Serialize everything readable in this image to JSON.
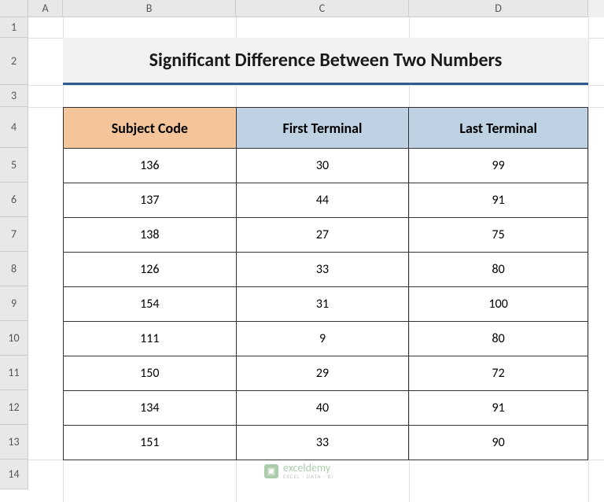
{
  "columns": [
    "A",
    "B",
    "C",
    "D"
  ],
  "rows": [
    "1",
    "2",
    "3",
    "4",
    "5",
    "6",
    "7",
    "8",
    "9",
    "10",
    "11",
    "12",
    "13",
    "14"
  ],
  "title": "Significant Difference Between Two Numbers",
  "headers": {
    "subject": "Subject Code",
    "first": "First Terminal",
    "last": "Last Terminal"
  },
  "chart_data": {
    "type": "table",
    "title": "Significant Difference Between Two Numbers",
    "columns": [
      "Subject Code",
      "First Terminal",
      "Last Terminal"
    ],
    "rows": [
      {
        "subject": "136",
        "first": "30",
        "last": "99"
      },
      {
        "subject": "137",
        "first": "44",
        "last": "91"
      },
      {
        "subject": "138",
        "first": "27",
        "last": "75"
      },
      {
        "subject": "126",
        "first": "33",
        "last": "80"
      },
      {
        "subject": "154",
        "first": "31",
        "last": "100"
      },
      {
        "subject": "111",
        "first": "9",
        "last": "80"
      },
      {
        "subject": "150",
        "first": "29",
        "last": "72"
      },
      {
        "subject": "134",
        "first": "40",
        "last": "91"
      },
      {
        "subject": "151",
        "first": "33",
        "last": "90"
      }
    ]
  },
  "watermark": {
    "brand": "exceldemy",
    "sub": "EXCEL · DATA · BI",
    "icon": "▣"
  },
  "colors": {
    "title_underline": "#2e5b8f",
    "subject_header_bg": "#f4c49b",
    "terminal_header_bg": "#bed2e3"
  }
}
